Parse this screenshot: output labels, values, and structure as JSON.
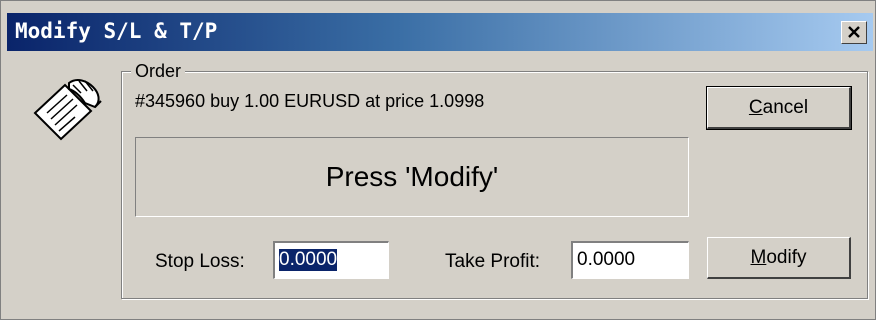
{
  "window": {
    "title": "Modify S/L & T/P",
    "close_glyph": "✕"
  },
  "order": {
    "group_label": "Order",
    "description": "#345960  buy 1.00 EURUSD at price 1.0998"
  },
  "message": "Press 'Modify'",
  "buttons": {
    "cancel_prefix": "",
    "cancel_accel": "C",
    "cancel_rest": "ancel",
    "modify_prefix": "",
    "modify_accel": "M",
    "modify_rest": "odify"
  },
  "stop_loss": {
    "label": "Stop Loss:",
    "value": "0.0000"
  },
  "take_profit": {
    "label": "Take Profit:",
    "value": "0.0000"
  },
  "icons": {
    "order_icon": "hand-document-icon",
    "close_icon": "close-icon"
  },
  "colors": {
    "title_start": "#0a246a",
    "title_end": "#a6caf0",
    "face": "#d4d0c8",
    "selection": "#0a246a"
  }
}
